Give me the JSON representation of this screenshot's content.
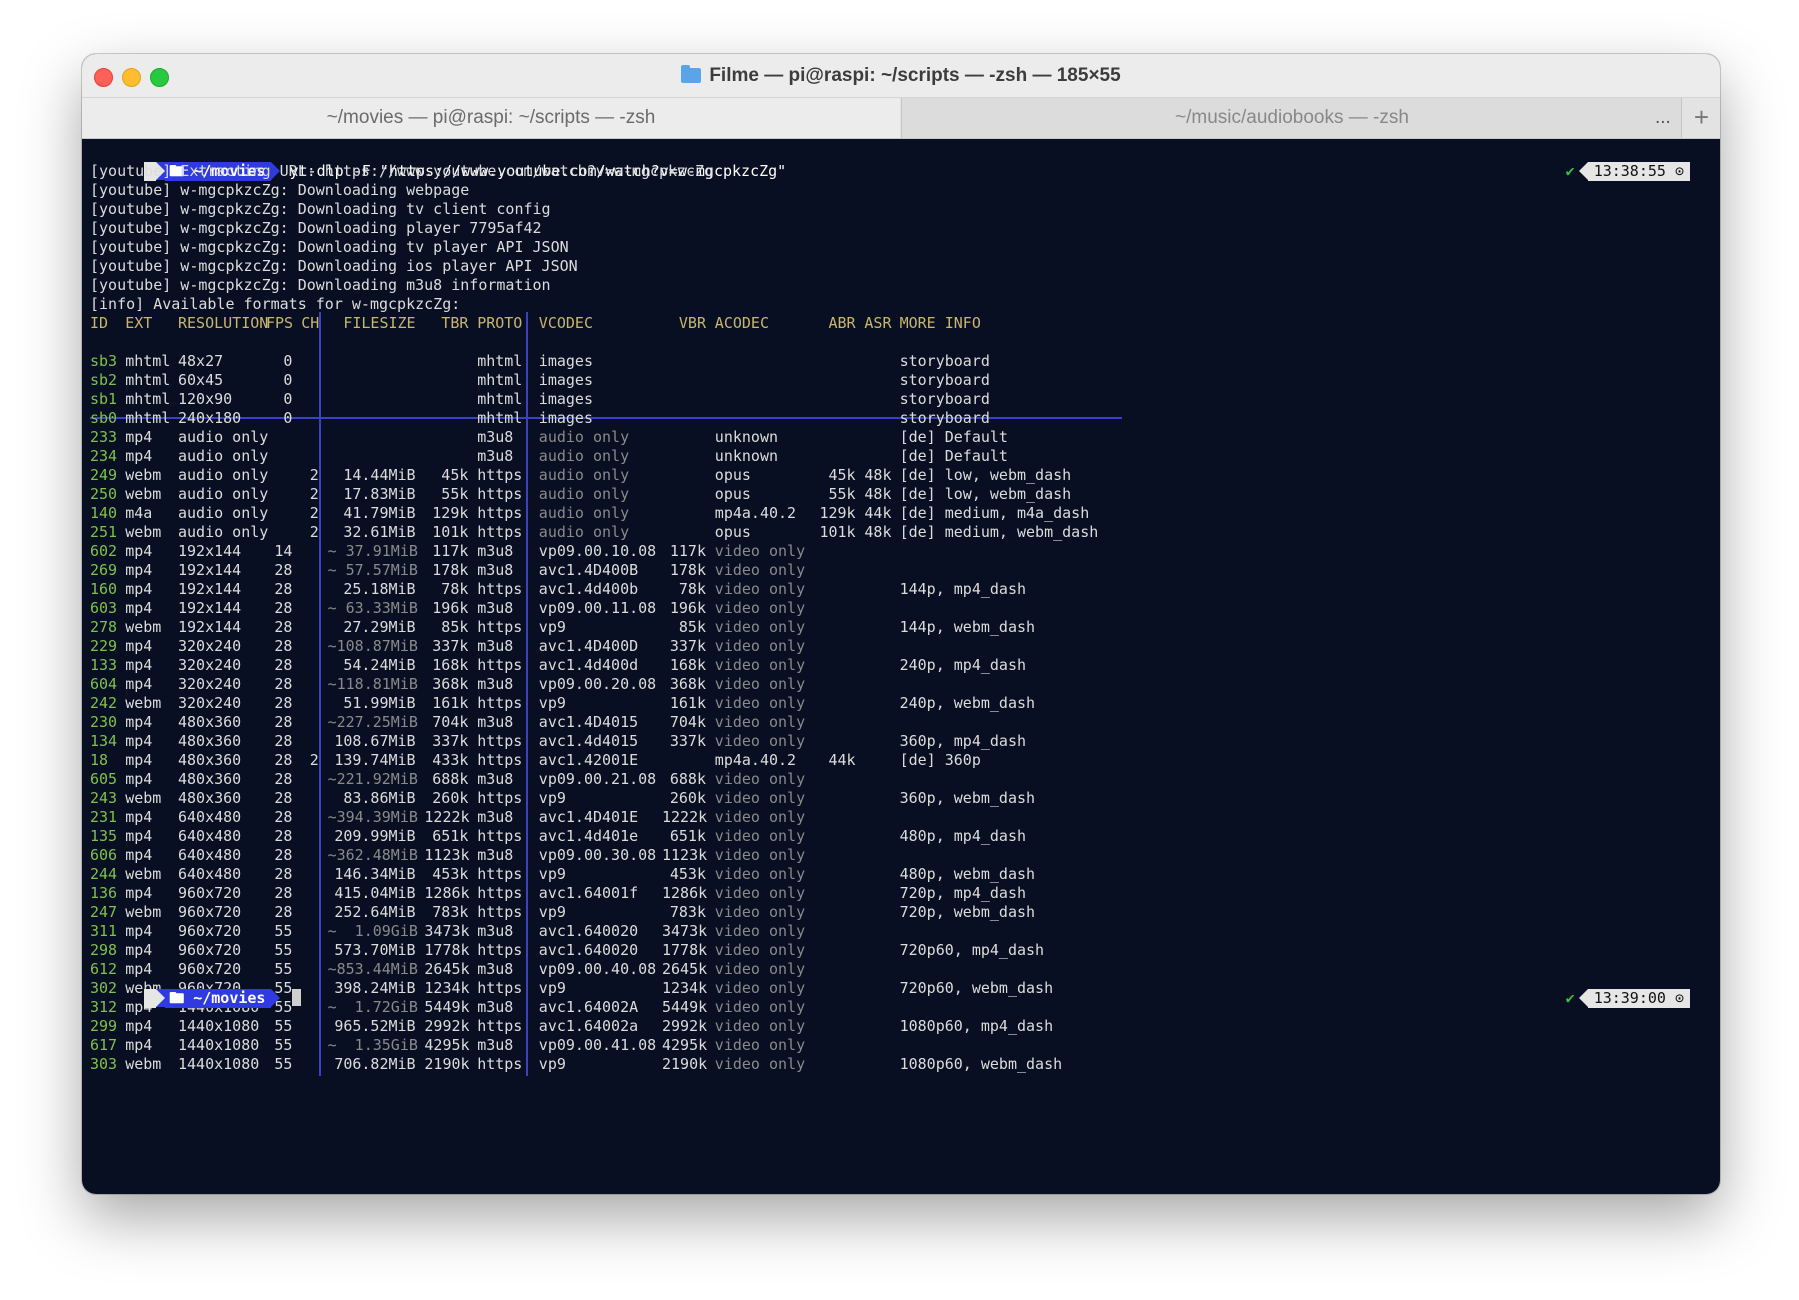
{
  "window": {
    "title": "Filme — pi@raspi: ~/scripts — -zsh — 185×55",
    "tabs": [
      {
        "label": "~/movies — pi@raspi: ~/scripts — -zsh",
        "active": true
      },
      {
        "label": "~/music/audiobooks — -zsh",
        "active": false
      }
    ],
    "tab_overflow": "...",
    "tab_add": "+"
  },
  "prompt": {
    "apple": "",
    "dir": "~/movies",
    "command": "yt-dlp -F \"https://www.youtube.com/watch?v=w-mgcpkzcZg\"",
    "rprompt_check": "✔",
    "rprompt_time": "13:38:55",
    "final_time": "13:39:00"
  },
  "log_lines": [
    "[youtube] Extracting URL: https://www.youtube.com/watch?v=w-mgcpkzcZg",
    "[youtube] w-mgcpkzcZg: Downloading webpage",
    "[youtube] w-mgcpkzcZg: Downloading tv client config",
    "[youtube] w-mgcpkzcZg: Downloading player 7795af42",
    "[youtube] w-mgcpkzcZg: Downloading tv player API JSON",
    "[youtube] w-mgcpkzcZg: Downloading ios player API JSON",
    "[youtube] w-mgcpkzcZg: Downloading m3u8 information",
    "[info] Available formats for w-mgcpkzcZg:"
  ],
  "headers": [
    "ID",
    "EXT",
    "RESOLUTION",
    "FPS",
    "CH",
    "FILESIZE",
    "TBR",
    "PROTO",
    "VCODEC",
    "VBR",
    "ACODEC",
    "ABR",
    "ASR",
    "MORE INFO"
  ],
  "formats": [
    {
      "id": "sb3",
      "ext": "mhtml",
      "res": "48x27",
      "fps": "0",
      "ch": "",
      "size": "",
      "tbr": "",
      "proto": "mhtml",
      "vcodec": "images",
      "vbr": "",
      "acodec": "",
      "abr": "",
      "asr": "",
      "info": "storyboard"
    },
    {
      "id": "sb2",
      "ext": "mhtml",
      "res": "60x45",
      "fps": "0",
      "ch": "",
      "size": "",
      "tbr": "",
      "proto": "mhtml",
      "vcodec": "images",
      "vbr": "",
      "acodec": "",
      "abr": "",
      "asr": "",
      "info": "storyboard"
    },
    {
      "id": "sb1",
      "ext": "mhtml",
      "res": "120x90",
      "fps": "0",
      "ch": "",
      "size": "",
      "tbr": "",
      "proto": "mhtml",
      "vcodec": "images",
      "vbr": "",
      "acodec": "",
      "abr": "",
      "asr": "",
      "info": "storyboard"
    },
    {
      "id": "sb0",
      "ext": "mhtml",
      "res": "240x180",
      "fps": "0",
      "ch": "",
      "size": "",
      "tbr": "",
      "proto": "mhtml",
      "vcodec": "images",
      "vbr": "",
      "acodec": "",
      "abr": "",
      "asr": "",
      "info": "storyboard"
    },
    {
      "id": "233",
      "ext": "mp4",
      "res": "audio only",
      "fps": "",
      "ch": "",
      "size": "",
      "tbr": "",
      "proto": "m3u8",
      "vcodec": "audio only",
      "vbr": "",
      "acodec": "unknown",
      "abr": "",
      "asr": "",
      "info": "[de] Default"
    },
    {
      "id": "234",
      "ext": "mp4",
      "res": "audio only",
      "fps": "",
      "ch": "",
      "size": "",
      "tbr": "",
      "proto": "m3u8",
      "vcodec": "audio only",
      "vbr": "",
      "acodec": "unknown",
      "abr": "",
      "asr": "",
      "info": "[de] Default"
    },
    {
      "id": "249",
      "ext": "webm",
      "res": "audio only",
      "fps": "",
      "ch": "2",
      "size": "14.44MiB",
      "tbr": "45k",
      "proto": "https",
      "vcodec": "audio only",
      "vbr": "",
      "acodec": "opus",
      "abr": "45k",
      "asr": "48k",
      "info": "[de] low, webm_dash"
    },
    {
      "id": "250",
      "ext": "webm",
      "res": "audio only",
      "fps": "",
      "ch": "2",
      "size": "17.83MiB",
      "tbr": "55k",
      "proto": "https",
      "vcodec": "audio only",
      "vbr": "",
      "acodec": "opus",
      "abr": "55k",
      "asr": "48k",
      "info": "[de] low, webm_dash"
    },
    {
      "id": "140",
      "ext": "m4a",
      "res": "audio only",
      "fps": "",
      "ch": "2",
      "size": "41.79MiB",
      "tbr": "129k",
      "proto": "https",
      "vcodec": "audio only",
      "vbr": "",
      "acodec": "mp4a.40.2",
      "abr": "129k",
      "asr": "44k",
      "info": "[de] medium, m4a_dash"
    },
    {
      "id": "251",
      "ext": "webm",
      "res": "audio only",
      "fps": "",
      "ch": "2",
      "size": "32.61MiB",
      "tbr": "101k",
      "proto": "https",
      "vcodec": "audio only",
      "vbr": "",
      "acodec": "opus",
      "abr": "101k",
      "asr": "48k",
      "info": "[de] medium, webm_dash"
    },
    {
      "id": "602",
      "ext": "mp4",
      "res": "192x144",
      "fps": "14",
      "ch": "",
      "size": "~ 37.91MiB",
      "tbr": "117k",
      "proto": "m3u8",
      "vcodec": "vp09.00.10.08",
      "vbr": "117k",
      "acodec": "video only",
      "abr": "",
      "asr": "",
      "info": ""
    },
    {
      "id": "269",
      "ext": "mp4",
      "res": "192x144",
      "fps": "28",
      "ch": "",
      "size": "~ 57.57MiB",
      "tbr": "178k",
      "proto": "m3u8",
      "vcodec": "avc1.4D400B",
      "vbr": "178k",
      "acodec": "video only",
      "abr": "",
      "asr": "",
      "info": ""
    },
    {
      "id": "160",
      "ext": "mp4",
      "res": "192x144",
      "fps": "28",
      "ch": "",
      "size": "25.18MiB",
      "tbr": "78k",
      "proto": "https",
      "vcodec": "avc1.4d400b",
      "vbr": "78k",
      "acodec": "video only",
      "abr": "",
      "asr": "",
      "info": "144p, mp4_dash"
    },
    {
      "id": "603",
      "ext": "mp4",
      "res": "192x144",
      "fps": "28",
      "ch": "",
      "size": "~ 63.33MiB",
      "tbr": "196k",
      "proto": "m3u8",
      "vcodec": "vp09.00.11.08",
      "vbr": "196k",
      "acodec": "video only",
      "abr": "",
      "asr": "",
      "info": ""
    },
    {
      "id": "278",
      "ext": "webm",
      "res": "192x144",
      "fps": "28",
      "ch": "",
      "size": "27.29MiB",
      "tbr": "85k",
      "proto": "https",
      "vcodec": "vp9",
      "vbr": "85k",
      "acodec": "video only",
      "abr": "",
      "asr": "",
      "info": "144p, webm_dash"
    },
    {
      "id": "229",
      "ext": "mp4",
      "res": "320x240",
      "fps": "28",
      "ch": "",
      "size": "~108.87MiB",
      "tbr": "337k",
      "proto": "m3u8",
      "vcodec": "avc1.4D400D",
      "vbr": "337k",
      "acodec": "video only",
      "abr": "",
      "asr": "",
      "info": ""
    },
    {
      "id": "133",
      "ext": "mp4",
      "res": "320x240",
      "fps": "28",
      "ch": "",
      "size": "54.24MiB",
      "tbr": "168k",
      "proto": "https",
      "vcodec": "avc1.4d400d",
      "vbr": "168k",
      "acodec": "video only",
      "abr": "",
      "asr": "",
      "info": "240p, mp4_dash"
    },
    {
      "id": "604",
      "ext": "mp4",
      "res": "320x240",
      "fps": "28",
      "ch": "",
      "size": "~118.81MiB",
      "tbr": "368k",
      "proto": "m3u8",
      "vcodec": "vp09.00.20.08",
      "vbr": "368k",
      "acodec": "video only",
      "abr": "",
      "asr": "",
      "info": ""
    },
    {
      "id": "242",
      "ext": "webm",
      "res": "320x240",
      "fps": "28",
      "ch": "",
      "size": "51.99MiB",
      "tbr": "161k",
      "proto": "https",
      "vcodec": "vp9",
      "vbr": "161k",
      "acodec": "video only",
      "abr": "",
      "asr": "",
      "info": "240p, webm_dash"
    },
    {
      "id": "230",
      "ext": "mp4",
      "res": "480x360",
      "fps": "28",
      "ch": "",
      "size": "~227.25MiB",
      "tbr": "704k",
      "proto": "m3u8",
      "vcodec": "avc1.4D4015",
      "vbr": "704k",
      "acodec": "video only",
      "abr": "",
      "asr": "",
      "info": ""
    },
    {
      "id": "134",
      "ext": "mp4",
      "res": "480x360",
      "fps": "28",
      "ch": "",
      "size": "108.67MiB",
      "tbr": "337k",
      "proto": "https",
      "vcodec": "avc1.4d4015",
      "vbr": "337k",
      "acodec": "video only",
      "abr": "",
      "asr": "",
      "info": "360p, mp4_dash"
    },
    {
      "id": "18",
      "ext": "mp4",
      "res": "480x360",
      "fps": "28",
      "ch": "2",
      "size": "139.74MiB",
      "tbr": "433k",
      "proto": "https",
      "vcodec": "avc1.42001E",
      "vbr": "",
      "acodec": "mp4a.40.2",
      "abr": "44k",
      "asr": "",
      "info": "[de] 360p"
    },
    {
      "id": "605",
      "ext": "mp4",
      "res": "480x360",
      "fps": "28",
      "ch": "",
      "size": "~221.92MiB",
      "tbr": "688k",
      "proto": "m3u8",
      "vcodec": "vp09.00.21.08",
      "vbr": "688k",
      "acodec": "video only",
      "abr": "",
      "asr": "",
      "info": ""
    },
    {
      "id": "243",
      "ext": "webm",
      "res": "480x360",
      "fps": "28",
      "ch": "",
      "size": "83.86MiB",
      "tbr": "260k",
      "proto": "https",
      "vcodec": "vp9",
      "vbr": "260k",
      "acodec": "video only",
      "abr": "",
      "asr": "",
      "info": "360p, webm_dash"
    },
    {
      "id": "231",
      "ext": "mp4",
      "res": "640x480",
      "fps": "28",
      "ch": "",
      "size": "~394.39MiB",
      "tbr": "1222k",
      "proto": "m3u8",
      "vcodec": "avc1.4D401E",
      "vbr": "1222k",
      "acodec": "video only",
      "abr": "",
      "asr": "",
      "info": ""
    },
    {
      "id": "135",
      "ext": "mp4",
      "res": "640x480",
      "fps": "28",
      "ch": "",
      "size": "209.99MiB",
      "tbr": "651k",
      "proto": "https",
      "vcodec": "avc1.4d401e",
      "vbr": "651k",
      "acodec": "video only",
      "abr": "",
      "asr": "",
      "info": "480p, mp4_dash"
    },
    {
      "id": "606",
      "ext": "mp4",
      "res": "640x480",
      "fps": "28",
      "ch": "",
      "size": "~362.48MiB",
      "tbr": "1123k",
      "proto": "m3u8",
      "vcodec": "vp09.00.30.08",
      "vbr": "1123k",
      "acodec": "video only",
      "abr": "",
      "asr": "",
      "info": ""
    },
    {
      "id": "244",
      "ext": "webm",
      "res": "640x480",
      "fps": "28",
      "ch": "",
      "size": "146.34MiB",
      "tbr": "453k",
      "proto": "https",
      "vcodec": "vp9",
      "vbr": "453k",
      "acodec": "video only",
      "abr": "",
      "asr": "",
      "info": "480p, webm_dash"
    },
    {
      "id": "136",
      "ext": "mp4",
      "res": "960x720",
      "fps": "28",
      "ch": "",
      "size": "415.04MiB",
      "tbr": "1286k",
      "proto": "https",
      "vcodec": "avc1.64001f",
      "vbr": "1286k",
      "acodec": "video only",
      "abr": "",
      "asr": "",
      "info": "720p, mp4_dash"
    },
    {
      "id": "247",
      "ext": "webm",
      "res": "960x720",
      "fps": "28",
      "ch": "",
      "size": "252.64MiB",
      "tbr": "783k",
      "proto": "https",
      "vcodec": "vp9",
      "vbr": "783k",
      "acodec": "video only",
      "abr": "",
      "asr": "",
      "info": "720p, webm_dash"
    },
    {
      "id": "311",
      "ext": "mp4",
      "res": "960x720",
      "fps": "55",
      "ch": "",
      "size": "~  1.09GiB",
      "tbr": "3473k",
      "proto": "m3u8",
      "vcodec": "avc1.640020",
      "vbr": "3473k",
      "acodec": "video only",
      "abr": "",
      "asr": "",
      "info": ""
    },
    {
      "id": "298",
      "ext": "mp4",
      "res": "960x720",
      "fps": "55",
      "ch": "",
      "size": "573.70MiB",
      "tbr": "1778k",
      "proto": "https",
      "vcodec": "avc1.640020",
      "vbr": "1778k",
      "acodec": "video only",
      "abr": "",
      "asr": "",
      "info": "720p60, mp4_dash"
    },
    {
      "id": "612",
      "ext": "mp4",
      "res": "960x720",
      "fps": "55",
      "ch": "",
      "size": "~853.44MiB",
      "tbr": "2645k",
      "proto": "m3u8",
      "vcodec": "vp09.00.40.08",
      "vbr": "2645k",
      "acodec": "video only",
      "abr": "",
      "asr": "",
      "info": ""
    },
    {
      "id": "302",
      "ext": "webm",
      "res": "960x720",
      "fps": "55",
      "ch": "",
      "size": "398.24MiB",
      "tbr": "1234k",
      "proto": "https",
      "vcodec": "vp9",
      "vbr": "1234k",
      "acodec": "video only",
      "abr": "",
      "asr": "",
      "info": "720p60, webm_dash"
    },
    {
      "id": "312",
      "ext": "mp4",
      "res": "1440x1080",
      "fps": "55",
      "ch": "",
      "size": "~  1.72GiB",
      "tbr": "5449k",
      "proto": "m3u8",
      "vcodec": "avc1.64002A",
      "vbr": "5449k",
      "acodec": "video only",
      "abr": "",
      "asr": "",
      "info": ""
    },
    {
      "id": "299",
      "ext": "mp4",
      "res": "1440x1080",
      "fps": "55",
      "ch": "",
      "size": "965.52MiB",
      "tbr": "2992k",
      "proto": "https",
      "vcodec": "avc1.64002a",
      "vbr": "2992k",
      "acodec": "video only",
      "abr": "",
      "asr": "",
      "info": "1080p60, mp4_dash"
    },
    {
      "id": "617",
      "ext": "mp4",
      "res": "1440x1080",
      "fps": "55",
      "ch": "",
      "size": "~  1.35GiB",
      "tbr": "4295k",
      "proto": "m3u8",
      "vcodec": "vp09.00.41.08",
      "vbr": "4295k",
      "acodec": "video only",
      "abr": "",
      "asr": "",
      "info": ""
    },
    {
      "id": "303",
      "ext": "webm",
      "res": "1440x1080",
      "fps": "55",
      "ch": "",
      "size": "706.82MiB",
      "tbr": "2190k",
      "proto": "https",
      "vcodec": "vp9",
      "vbr": "2190k",
      "acodec": "video only",
      "abr": "",
      "asr": "",
      "info": "1080p60, webm_dash"
    }
  ],
  "colors": {
    "terminal_bg": "#090f22",
    "id_green": "#7cc24c",
    "header_yellow": "#c8b66c",
    "separator_blue": "#3a40c8",
    "prompt_blue": "#2f3be0"
  }
}
